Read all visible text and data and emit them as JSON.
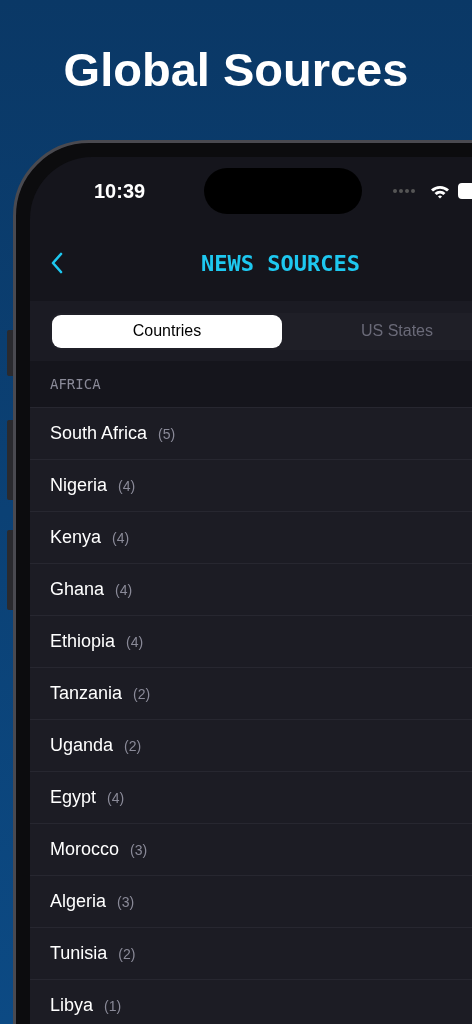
{
  "headline": "Global Sources",
  "status_bar": {
    "time": "10:39"
  },
  "nav": {
    "title": "NEWS SOURCES"
  },
  "segments": [
    {
      "label": "Countries",
      "selected": true
    },
    {
      "label": "US States",
      "selected": false
    }
  ],
  "sections": [
    {
      "header": "AFRICA",
      "rows": [
        {
          "name": "South Africa",
          "count": "(5)"
        },
        {
          "name": "Nigeria",
          "count": "(4)"
        },
        {
          "name": "Kenya",
          "count": "(4)"
        },
        {
          "name": "Ghana",
          "count": "(4)"
        },
        {
          "name": "Ethiopia",
          "count": "(4)"
        },
        {
          "name": "Tanzania",
          "count": "(2)"
        },
        {
          "name": "Uganda",
          "count": "(2)"
        },
        {
          "name": "Egypt",
          "count": "(4)"
        },
        {
          "name": "Morocco",
          "count": "(3)"
        },
        {
          "name": "Algeria",
          "count": "(3)"
        },
        {
          "name": "Tunisia",
          "count": "(2)"
        },
        {
          "name": "Libya",
          "count": "(1)"
        }
      ]
    }
  ]
}
